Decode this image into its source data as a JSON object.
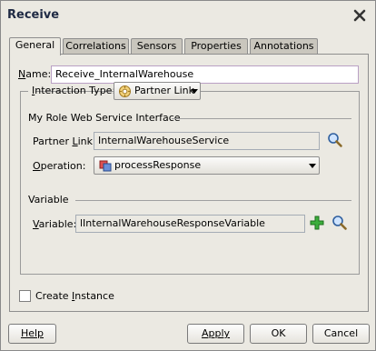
{
  "window": {
    "title": "Receive"
  },
  "tabs": [
    {
      "label": "General"
    },
    {
      "label": "Correlations"
    },
    {
      "label": "Sensors"
    },
    {
      "label": "Properties"
    },
    {
      "label": "Annotations"
    }
  ],
  "general": {
    "name_label": "Name:",
    "name_value": "Receive_InternalWarehouse",
    "interaction_type_label": "Interaction Type:",
    "interaction_type_value": "Partner Link",
    "role_section_label": "My Role Web Service Interface",
    "partner_link_label": "Partner Link:",
    "partner_link_value": "InternalWarehouseService",
    "operation_label": "Operation:",
    "operation_value": "processResponse",
    "variable_section_label": "Variable",
    "variable_label": "Variable:",
    "variable_value": "lInternalWarehouseResponseVariable",
    "create_instance_label": "Create Instance"
  },
  "buttons": {
    "help": "Help",
    "apply": "Apply",
    "ok": "OK",
    "cancel": "Cancel"
  },
  "icons": {
    "close": "close-icon",
    "search": "search-icon",
    "add": "add-icon",
    "partner_link": "partner-link-icon",
    "operation": "operation-icon"
  }
}
